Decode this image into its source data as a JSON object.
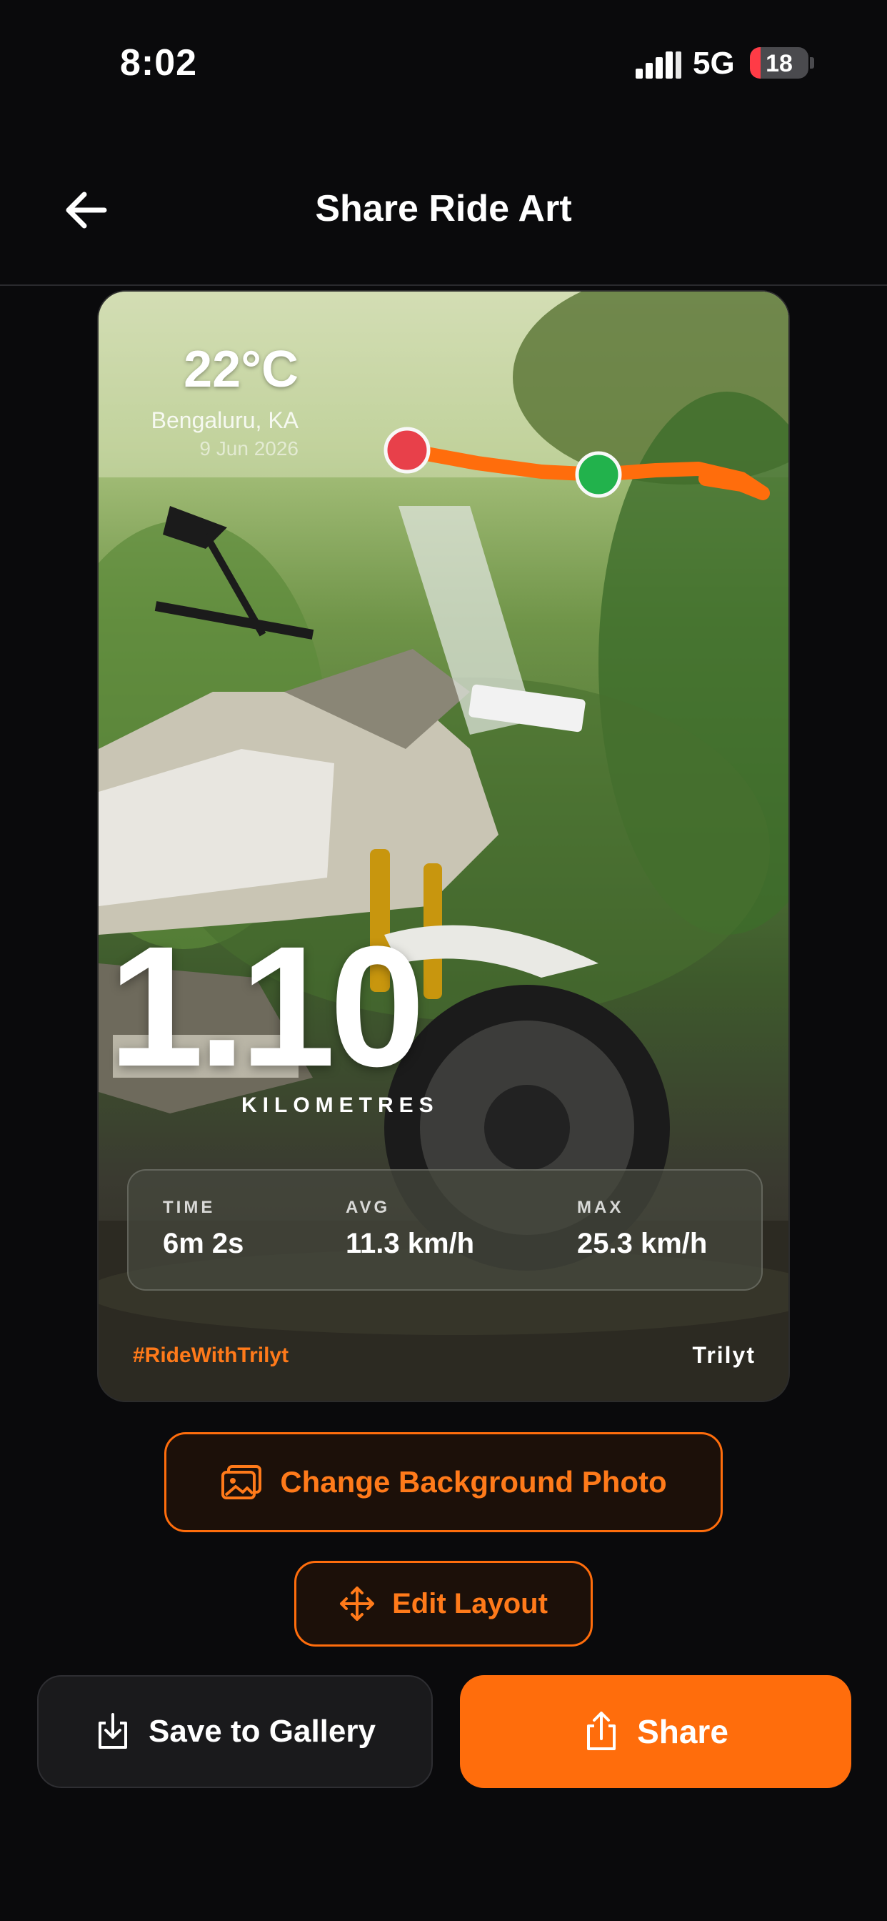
{
  "status_bar": {
    "time": "8:02",
    "network": "5G",
    "battery": "18",
    "battery_level": 0.18
  },
  "header": {
    "title": "Share Ride Art",
    "back_icon": "arrow-left-icon"
  },
  "card": {
    "temperature": "22°C",
    "location": "Bengaluru, KA",
    "date": "9 Jun 2026",
    "distance": "1.10",
    "distance_unit": "KILOMETRES",
    "stats": [
      {
        "label": "TIME",
        "value": "6m 2s"
      },
      {
        "label": "AVG",
        "value": "11.3 km/h"
      },
      {
        "label": "MAX",
        "value": "25.3 km/h"
      }
    ],
    "hashtag": "#RideWithTrilyt",
    "brand": "Trilyt",
    "colors": {
      "route": "#ff6d0c",
      "start_marker": "#e8404a",
      "end_marker": "#22b24c"
    }
  },
  "actions": {
    "change_background": "Change Background Photo",
    "edit_layout": "Edit Layout",
    "save": "Save to Gallery",
    "share": "Share"
  },
  "accent_color": "#ff6d0c"
}
